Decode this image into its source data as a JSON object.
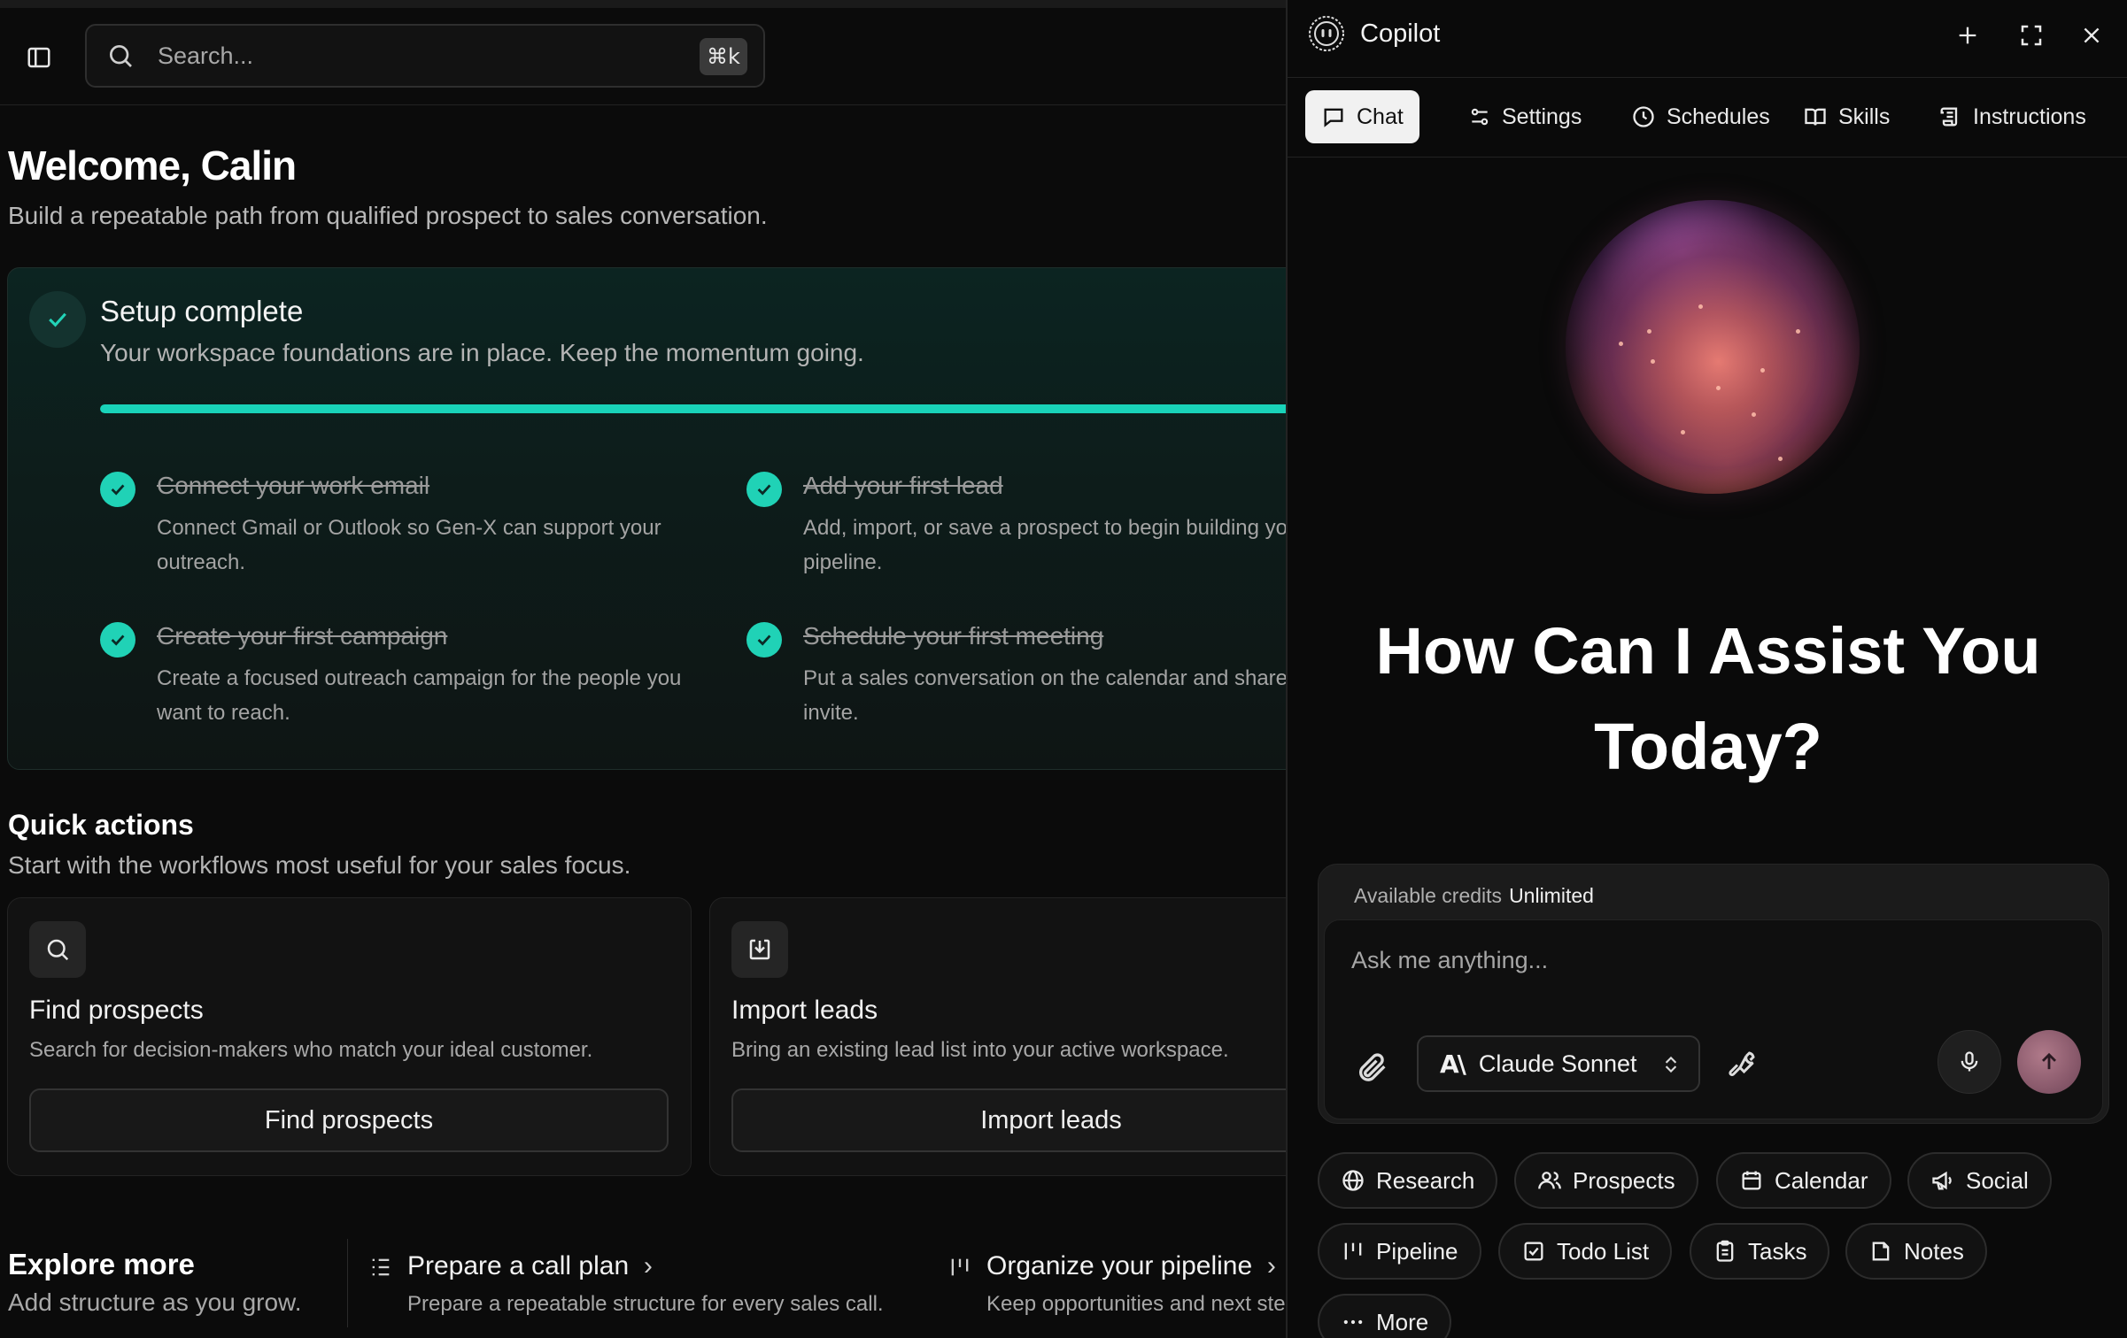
{
  "search": {
    "placeholder": "Search...",
    "shortcut": "⌘k"
  },
  "welcome": {
    "title": "Welcome, Calin",
    "subtitle": "Build a repeatable path from qualified prospect to sales conversation."
  },
  "setup": {
    "title": "Setup complete",
    "subtitle": "Your workspace foundations are in place. Keep the momentum going.",
    "progress": 1.0,
    "tasks": [
      {
        "title": "Connect your work email",
        "desc": "Connect Gmail or Outlook so Gen-X can support your outreach.",
        "done": true
      },
      {
        "title": "Add your first lead",
        "desc": "Add, import, or save a prospect to begin building your pipeline.",
        "done": true
      },
      {
        "title": "Create your first campaign",
        "desc": "Create a focused outreach campaign for the people you want to reach.",
        "done": true
      },
      {
        "title": "Schedule your first meeting",
        "desc": "Put a sales conversation on the calendar and share the invite.",
        "done": true
      }
    ]
  },
  "quick_actions": {
    "title": "Quick actions",
    "subtitle": "Start with the workflows most useful for your sales focus.",
    "cards": [
      {
        "icon": "search-icon",
        "title": "Find prospects",
        "desc": "Search for decision-makers who match your ideal customer.",
        "button": "Find prospects"
      },
      {
        "icon": "import-icon",
        "title": "Import leads",
        "desc": "Bring an existing lead list into your active workspace.",
        "button": "Import leads"
      }
    ]
  },
  "explore": {
    "title": "Explore more",
    "subtitle": "Add structure as you grow.",
    "items": [
      {
        "icon": "list-icon",
        "title": "Prepare a call plan",
        "desc": "Prepare a repeatable structure for every sales call."
      },
      {
        "icon": "pipeline-icon",
        "title": "Organize your pipeline",
        "desc": "Keep opportunities and next steps organized."
      }
    ]
  },
  "copilot": {
    "title": "Copilot",
    "tabs": [
      {
        "label": "Chat",
        "icon": "chat-icon",
        "active": true
      },
      {
        "label": "Settings",
        "icon": "settings-sliders-icon",
        "active": false
      },
      {
        "label": "Schedules",
        "icon": "clock-icon",
        "active": false
      },
      {
        "label": "Skills",
        "icon": "book-icon",
        "active": false
      },
      {
        "label": "Instructions",
        "icon": "scroll-icon",
        "active": false
      }
    ],
    "heading_line1": "How Can I Assist You",
    "heading_line2": "Today?",
    "credits_label": "Available credits",
    "credits_value": "Unlimited",
    "input_placeholder": "Ask me anything...",
    "model": "Claude Sonnet",
    "chips": [
      {
        "label": "Research",
        "icon": "globe-icon"
      },
      {
        "label": "Prospects",
        "icon": "users-icon"
      },
      {
        "label": "Calendar",
        "icon": "calendar-icon"
      },
      {
        "label": "Social",
        "icon": "megaphone-icon"
      },
      {
        "label": "Pipeline",
        "icon": "pipeline-icon"
      },
      {
        "label": "Todo List",
        "icon": "checkbox-icon"
      },
      {
        "label": "Tasks",
        "icon": "clipboard-icon"
      },
      {
        "label": "Notes",
        "icon": "note-icon"
      },
      {
        "label": "More",
        "icon": "ellipsis-icon"
      }
    ]
  },
  "colors": {
    "accent": "#19d3b9",
    "background": "#0a0a0a",
    "card": "#121212"
  }
}
